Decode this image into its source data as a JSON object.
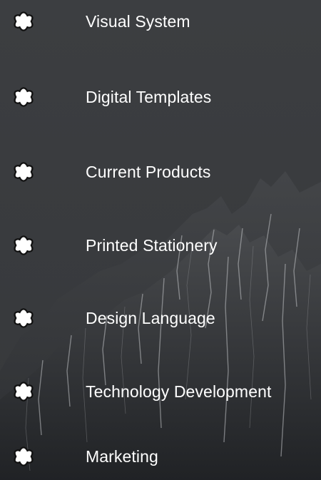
{
  "menu": {
    "items": [
      {
        "label": "Visual System",
        "icon": "flower-icon"
      },
      {
        "label": "Digital Templates",
        "icon": "flower-icon"
      },
      {
        "label": "Current Products",
        "icon": "flower-icon"
      },
      {
        "label": "Printed Stationery",
        "icon": "flower-icon"
      },
      {
        "label": "Design Language",
        "icon": "flower-icon"
      },
      {
        "label": "Technology Development",
        "icon": "flower-icon"
      },
      {
        "label": "Marketing",
        "icon": "flower-icon"
      }
    ]
  },
  "colors": {
    "text": "#ffffff",
    "icon_fill": "#ffffff",
    "icon_outline": "#111111",
    "background": "#3a3c3f"
  }
}
